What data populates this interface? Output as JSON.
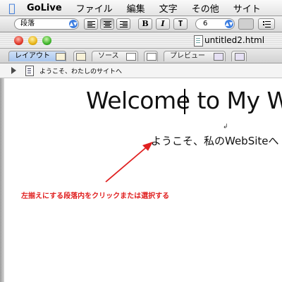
{
  "menubar": {
    "items": [
      "GoLive",
      "ファイル",
      "編集",
      "文字",
      "その他",
      "サイト"
    ]
  },
  "toolbar": {
    "paragraph_format": "段落",
    "bold_label": "B",
    "italic_label": "I",
    "teletype_label": "T",
    "font_size": "6"
  },
  "window": {
    "title": "untitled2.html"
  },
  "tabs": [
    {
      "label": "レイアウト",
      "active": true
    },
    {
      "label": "ソース",
      "active": false
    },
    {
      "label": "プレビュー",
      "active": false
    }
  ],
  "head": {
    "page_title": "ようこそ、わたしのサイトへ"
  },
  "content": {
    "heading": "Welcome to My We",
    "subheading": "ようこそ、私のWebSiteへ",
    "annotation": "左揃えにする段落内をクリックまたは選択する"
  },
  "colors": {
    "annotation": "#e02020",
    "active_tab": "#a8c6ee"
  }
}
